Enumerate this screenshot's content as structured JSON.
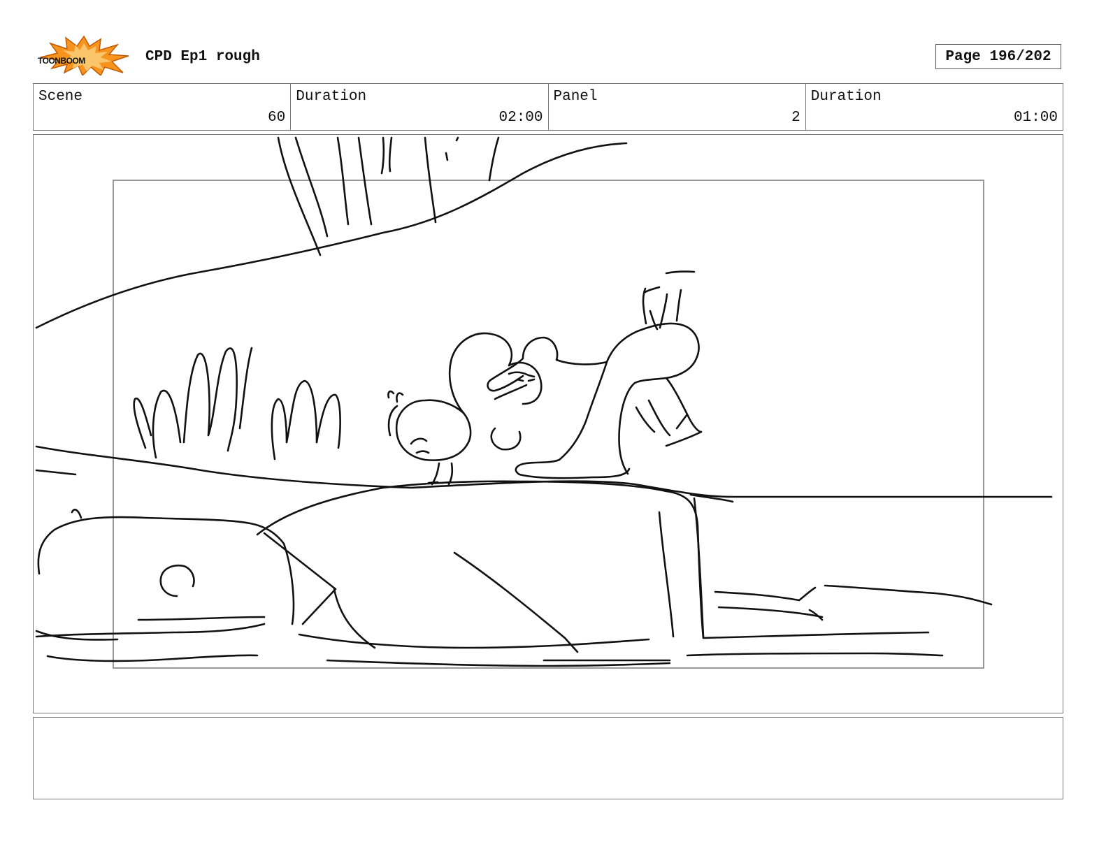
{
  "header": {
    "logo_text": "TOONBOOM",
    "title": "CPD Ep1 rough",
    "page_label": "Page 196/202"
  },
  "info": {
    "scene_label": "Scene",
    "scene_value": "60",
    "scene_duration_label": "Duration",
    "scene_duration_value": "02:00",
    "panel_label": "Panel",
    "panel_value": "2",
    "panel_duration_label": "Duration",
    "panel_duration_value": "01:00"
  },
  "notes": {
    "text": ""
  }
}
